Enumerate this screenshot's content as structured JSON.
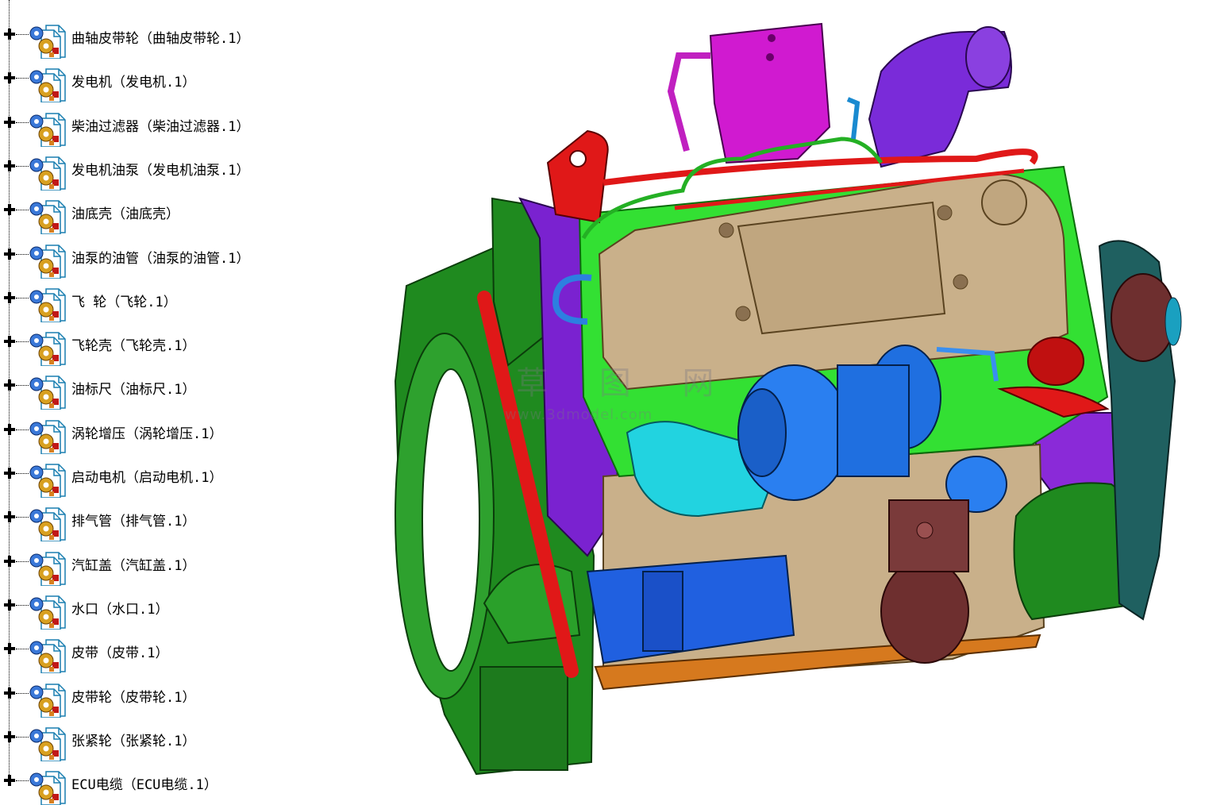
{
  "tree": {
    "items": [
      {
        "label": "曲轴皮带轮（曲轴皮带轮.1）"
      },
      {
        "label": "发电机（发电机.1）"
      },
      {
        "label": "柴油过滤器（柴油过滤器.1）"
      },
      {
        "label": "发电机油泵（发电机油泵.1）"
      },
      {
        "label": "油底壳（油底壳）"
      },
      {
        "label": "油泵的油管（油泵的油管.1）"
      },
      {
        "label": "飞 轮（飞轮.1）"
      },
      {
        "label": "飞轮壳（飞轮壳.1）"
      },
      {
        "label": "油标尺（油标尺.1）"
      },
      {
        "label": "涡轮增压（涡轮增压.1）"
      },
      {
        "label": "启动电机（启动电机.1）"
      },
      {
        "label": "排气管（排气管.1）"
      },
      {
        "label": "汽缸盖（汽缸盖.1）"
      },
      {
        "label": "水口（水口.1）"
      },
      {
        "label": "皮带（皮带.1）"
      },
      {
        "label": "皮带轮（皮带轮.1）"
      },
      {
        "label": "张紧轮（张紧轮.1）"
      },
      {
        "label": "ECU电缆（ECU电缆.1）"
      }
    ]
  },
  "watermark": {
    "text": "草 图 网",
    "url": "www.3dmodel.com"
  },
  "colors": {
    "housing_green": "#1f8a1f",
    "cylinder_head_tan": "#c9b08a",
    "turbo_blue": "#1f6fe0",
    "exhaust_cyan": "#22d3e0",
    "pipe_red": "#e01818",
    "intake_purple": "#7a2bd9",
    "filter_magenta": "#d01ad0",
    "filter_brown": "#6e2f2f",
    "frame_purple": "#7a22d0"
  }
}
